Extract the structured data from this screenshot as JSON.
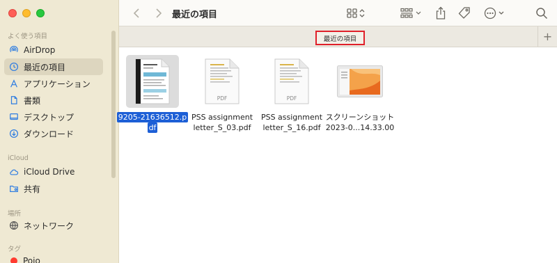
{
  "window": {
    "title": "最近の項目",
    "tab_label": "最近の項目",
    "tab_add": "+"
  },
  "sidebar": {
    "sections": {
      "favorites": "よく使う項目",
      "icloud": "iCloud",
      "locations": "場所",
      "tags": "タグ"
    },
    "favorites": [
      {
        "label": "AirDrop",
        "icon": "airdrop-icon"
      },
      {
        "label": "最近の項目",
        "icon": "clock-icon",
        "active": true
      },
      {
        "label": "アプリケーション",
        "icon": "applications-icon"
      },
      {
        "label": "書類",
        "icon": "document-icon"
      },
      {
        "label": "デスクトップ",
        "icon": "desktop-icon"
      },
      {
        "label": "ダウンロード",
        "icon": "download-icon"
      }
    ],
    "icloud": [
      {
        "label": "iCloud Drive",
        "icon": "cloud-icon"
      },
      {
        "label": "共有",
        "icon": "shared-folder-icon"
      }
    ],
    "locations": [
      {
        "label": "ネットワーク",
        "icon": "network-icon"
      }
    ],
    "tags": [
      {
        "label": "Pojo",
        "color": "#ff3b30"
      }
    ]
  },
  "files": [
    {
      "name_line1": "9205-21636512.p",
      "name_line2": "df",
      "kind": "pdf-preview",
      "selected": true
    },
    {
      "name_line1": "PSS assignment",
      "name_line2": "letter_S_03.pdf",
      "kind": "pdf",
      "badge": "PDF"
    },
    {
      "name_line1": "PSS assignment",
      "name_line2": "letter_S_16.pdf",
      "kind": "pdf",
      "badge": "PDF"
    },
    {
      "name_line1": "スクリーンショット",
      "name_line2": "2023-0...14.33.00",
      "kind": "screenshot"
    }
  ],
  "colors": {
    "sidebar_bg": "#efe9d3",
    "selection": "#1d5fd6",
    "highlight_box": "#e0202a",
    "accent_icon": "#2f7de1"
  }
}
